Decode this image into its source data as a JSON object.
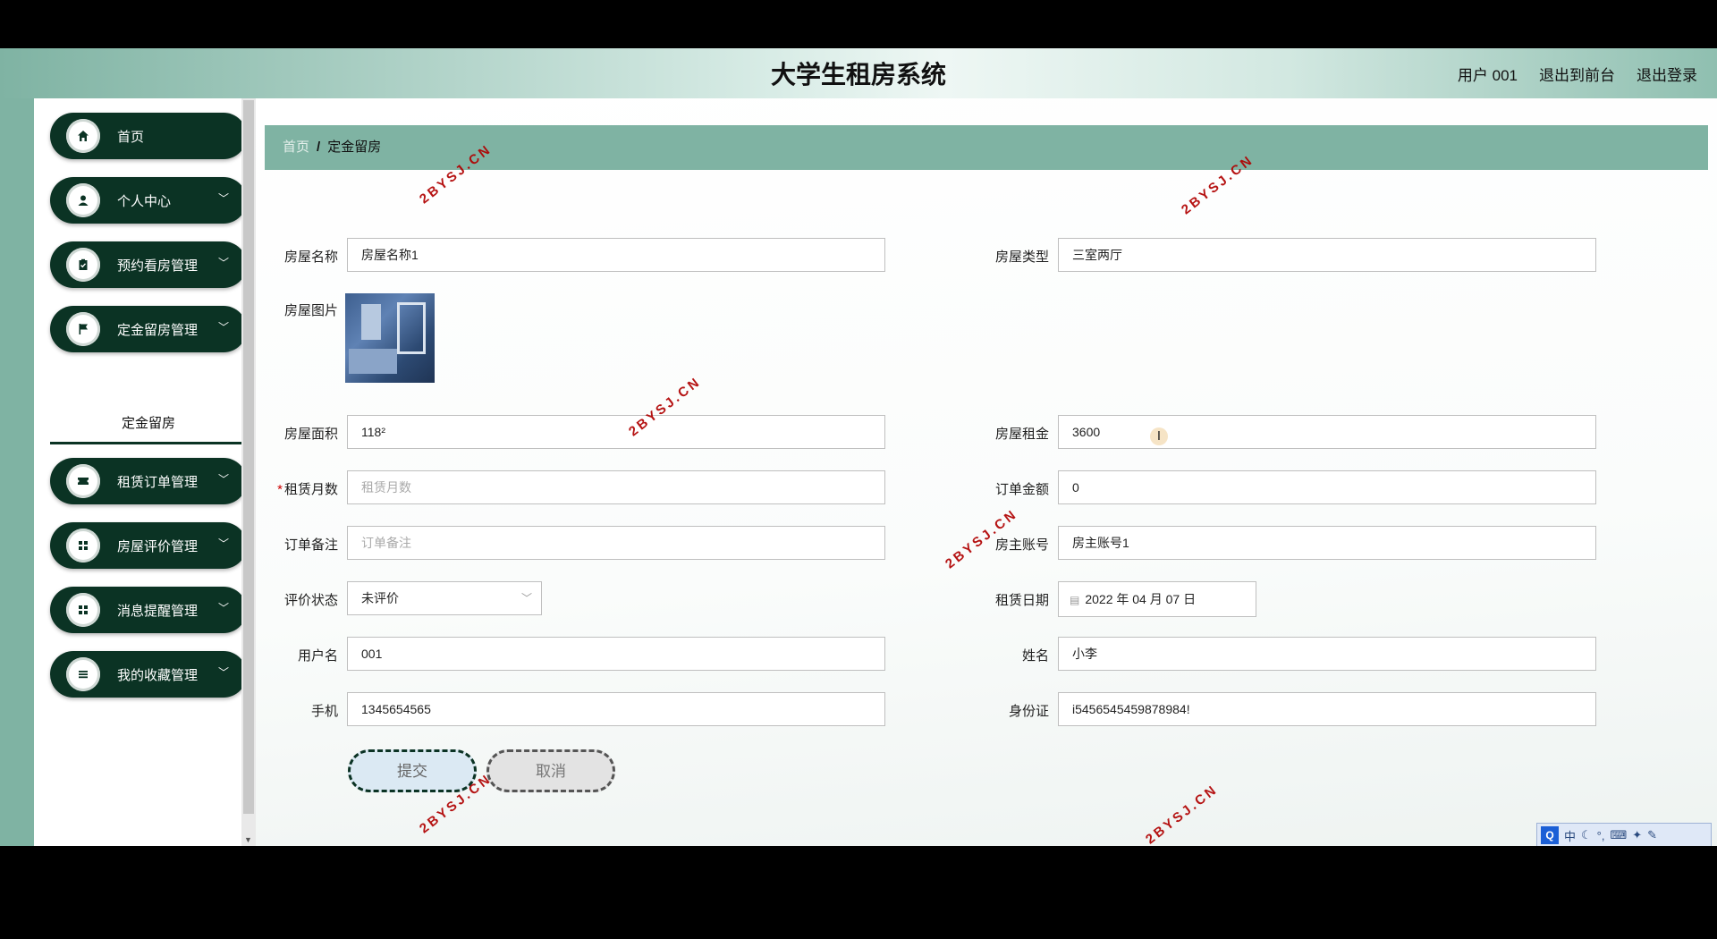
{
  "header": {
    "app_title": "大学生租房系统",
    "user_label": "用户 001",
    "front_link": "退出到前台",
    "logout_link": "退出登录"
  },
  "sidebar": {
    "items": [
      {
        "label": "首页",
        "icon": "home-icon"
      },
      {
        "label": "个人中心",
        "icon": "user-icon"
      },
      {
        "label": "预约看房管理",
        "icon": "clipboard-icon"
      },
      {
        "label": "定金留房管理",
        "icon": "flag-icon"
      },
      {
        "label": "租赁订单管理",
        "icon": "ticket-icon"
      },
      {
        "label": "房屋评价管理",
        "icon": "grid-icon"
      },
      {
        "label": "消息提醒管理",
        "icon": "grid-icon"
      },
      {
        "label": "我的收藏管理",
        "icon": "list-icon"
      }
    ],
    "submenu_active": "定金留房"
  },
  "breadcrumb": {
    "home": "首页",
    "separator": "/",
    "current": "定金留房"
  },
  "form": {
    "house_name": {
      "label": "房屋名称",
      "value": "房屋名称1"
    },
    "house_type": {
      "label": "房屋类型",
      "value": "三室两厅"
    },
    "house_image": {
      "label": "房屋图片"
    },
    "house_area": {
      "label": "房屋面积",
      "value": "118²"
    },
    "house_rent": {
      "label": "房屋租金",
      "value": "3600"
    },
    "rent_months": {
      "label": "租赁月数",
      "required_mark": "*",
      "placeholder": "租赁月数",
      "value": ""
    },
    "order_amount": {
      "label": "订单金额",
      "value": "0"
    },
    "order_note": {
      "label": "订单备注",
      "placeholder": "订单备注",
      "value": ""
    },
    "landlord_account": {
      "label": "房主账号",
      "value": "房主账号1"
    },
    "review_status": {
      "label": "评价状态",
      "value": "未评价"
    },
    "rent_date": {
      "label": "租赁日期",
      "value": "2022 年 04 月 07 日"
    },
    "username": {
      "label": "用户名",
      "value": "001"
    },
    "name": {
      "label": "姓名",
      "value": "小李"
    },
    "phone": {
      "label": "手机",
      "value": "1345654565"
    },
    "id_card": {
      "label": "身份证",
      "value": "i5456545459878984!"
    }
  },
  "buttons": {
    "submit": "提交",
    "cancel": "取消"
  },
  "watermark": "2BYSJ.CN",
  "ime_toolbar": {
    "logo": "Q",
    "mode": "中"
  },
  "colors": {
    "sidebar_dark": "#0b3324",
    "accent_green": "#7fb3a3",
    "watermark_red": "#b00000"
  }
}
